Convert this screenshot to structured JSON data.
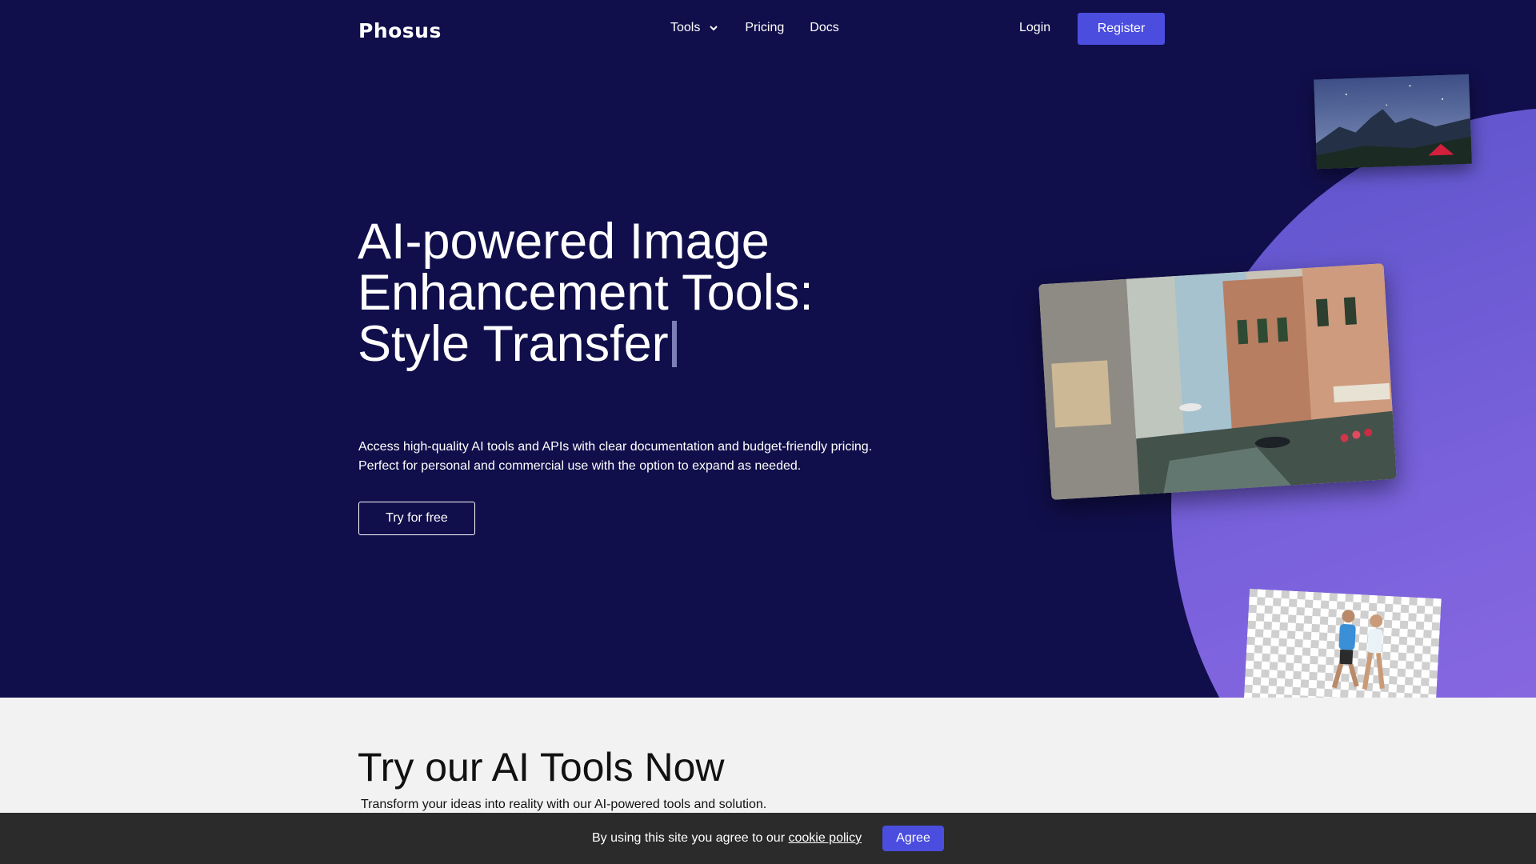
{
  "nav": {
    "logo": "Phosus",
    "links": [
      {
        "label": "Tools"
      },
      {
        "label": "Pricing"
      },
      {
        "label": "Docs"
      }
    ],
    "login": "Login",
    "register": "Register"
  },
  "hero": {
    "headline_line1": "AI-powered Image",
    "headline_line2": "Enhancement Tools:",
    "headline_line3": "Style Transfer",
    "desc_line1": "Access high-quality AI tools and APIs with clear documentation and budget-friendly pricing.",
    "desc_line2": "Perfect for personal and commercial use with the option to expand as needed.",
    "cta": "Try for free"
  },
  "section": {
    "title": "Try our AI Tools Now",
    "subtitle": "Transform your ideas into reality with our AI-powered tools and solution."
  },
  "cookie": {
    "text": "By using this site you agree to our",
    "link": "cookie policy",
    "button": "Agree"
  },
  "colors": {
    "hero_bg": "#110f4b",
    "accent": "#4b4ddf",
    "circle": "#7a62dc",
    "cookie_bg": "#2b2b2b"
  }
}
